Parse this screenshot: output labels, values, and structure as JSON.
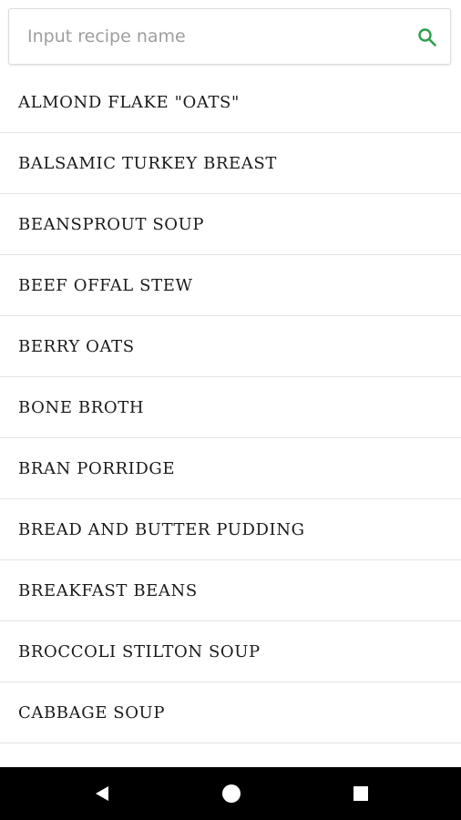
{
  "search": {
    "placeholder": "Input recipe name",
    "value": "",
    "icon": "search-icon",
    "icon_color": "#2e9e4a"
  },
  "recipes": [
    "ALMOND FLAKE \"OATS\"",
    "BALSAMIC TURKEY BREAST",
    "BEANSPROUT SOUP",
    "BEEF OFFAL STEW",
    "BERRY OATS",
    "BONE BROTH",
    "BRAN PORRIDGE",
    "BREAD AND BUTTER PUDDING",
    "BREAKFAST BEANS",
    "BROCCOLI STILTON SOUP",
    "CABBAGE SOUP"
  ],
  "nav_bar": {
    "background": "#000000",
    "icon_color": "#ffffff",
    "back_icon": "back-triangle-icon",
    "home_icon": "home-circle-icon",
    "recents_icon": "recents-square-icon"
  }
}
